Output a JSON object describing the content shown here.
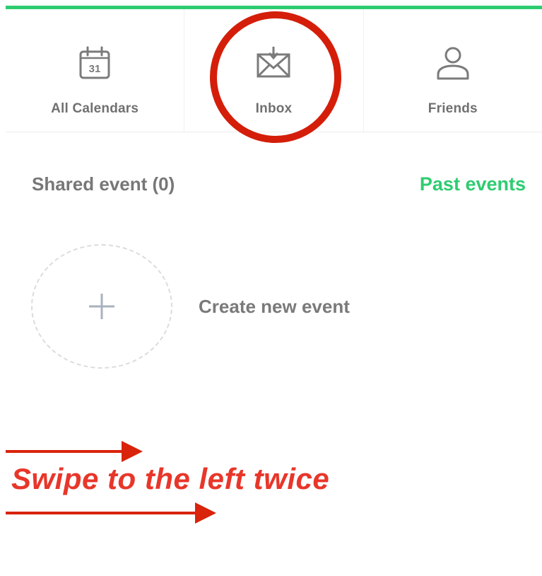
{
  "tabs": [
    {
      "label": "All Calendars",
      "icon": "calendar-icon",
      "icon_text": "31"
    },
    {
      "label": "Inbox",
      "icon": "inbox-download-icon"
    },
    {
      "label": "Friends",
      "icon": "person-icon"
    }
  ],
  "section": {
    "title": "Shared event (0)",
    "past_events_label": "Past events"
  },
  "create_event": {
    "label": "Create new event",
    "icon": "plus-icon"
  },
  "annotation": {
    "text": "Swipe to the left twice",
    "highlight": "circle around Inbox tab"
  },
  "colors": {
    "accent": "#2ecc71",
    "annotation": "#e8362a",
    "text_gray": "#777777"
  }
}
